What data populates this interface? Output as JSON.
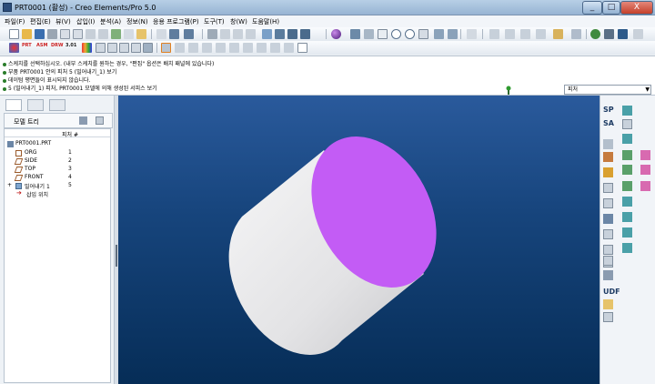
{
  "window": {
    "title": "PRT0001 (활성) - Creo Elements/Pro 5.0",
    "buttons": [
      "_",
      "□",
      "X"
    ]
  },
  "menu": [
    "파일(F)",
    "편집(E)",
    "뷰(V)",
    "삽입(I)",
    "분석(A)",
    "정보(N)",
    "응용 프로그램(P)",
    "도구(T)",
    "창(W)",
    "도움말(H)"
  ],
  "toolbar": {
    "row2_labels": [
      "PRT",
      "ASM",
      "DRW",
      "3.01"
    ]
  },
  "messages": [
    "스케치를 선택하십시오. (내부 스케치를 원하는 경우, \"편집\" 옵션은 배치 패널에 있습니다)",
    "부품 PRT0001 안의 피처 5 (밀어내기_1) 보기",
    "데이텀 평면들이 표시되지 않습니다.",
    "5 (밀어내기_1) 피처, PRT0001 모델에 의해 생성된 서피스 보기"
  ],
  "filter": {
    "value": "피처"
  },
  "model_tree": {
    "title": "모델 트리",
    "column_header": "피처 #",
    "root": "PRT0001.PRT",
    "items": [
      {
        "label": "ORG",
        "num": "1"
      },
      {
        "label": "SIDE",
        "num": "2"
      },
      {
        "label": "TOP",
        "num": "3"
      },
      {
        "label": "FRONT",
        "num": "4"
      },
      {
        "label": "밀어내기 1",
        "num": "5"
      },
      {
        "label": "삽입 위치",
        "num": ""
      }
    ]
  },
  "right_toolbar": {
    "labels": [
      "SP",
      "SA",
      "UDF"
    ]
  },
  "colors": {
    "viewport_top": "#2a5a9c",
    "viewport_bottom": "#062d57",
    "cylinder_body": "#e6e6e8",
    "cylinder_face": "#c35cf5"
  },
  "icons": [
    "new-icon",
    "open-icon",
    "save-icon",
    "print-icon",
    "undo-icon",
    "redo-icon",
    "cut-icon",
    "copy-icon",
    "paste-icon",
    "regenerate-icon",
    "search-icon",
    "zoom-in-icon",
    "zoom-out-icon",
    "refit-icon",
    "help-icon",
    "sketch-icon",
    "datum-plane-icon",
    "datum-axis-icon",
    "curve-icon",
    "extrude-icon",
    "revolve-icon",
    "hole-icon",
    "round-icon",
    "chamfer-icon",
    "shell-icon",
    "pattern-icon",
    "mirror-icon"
  ]
}
